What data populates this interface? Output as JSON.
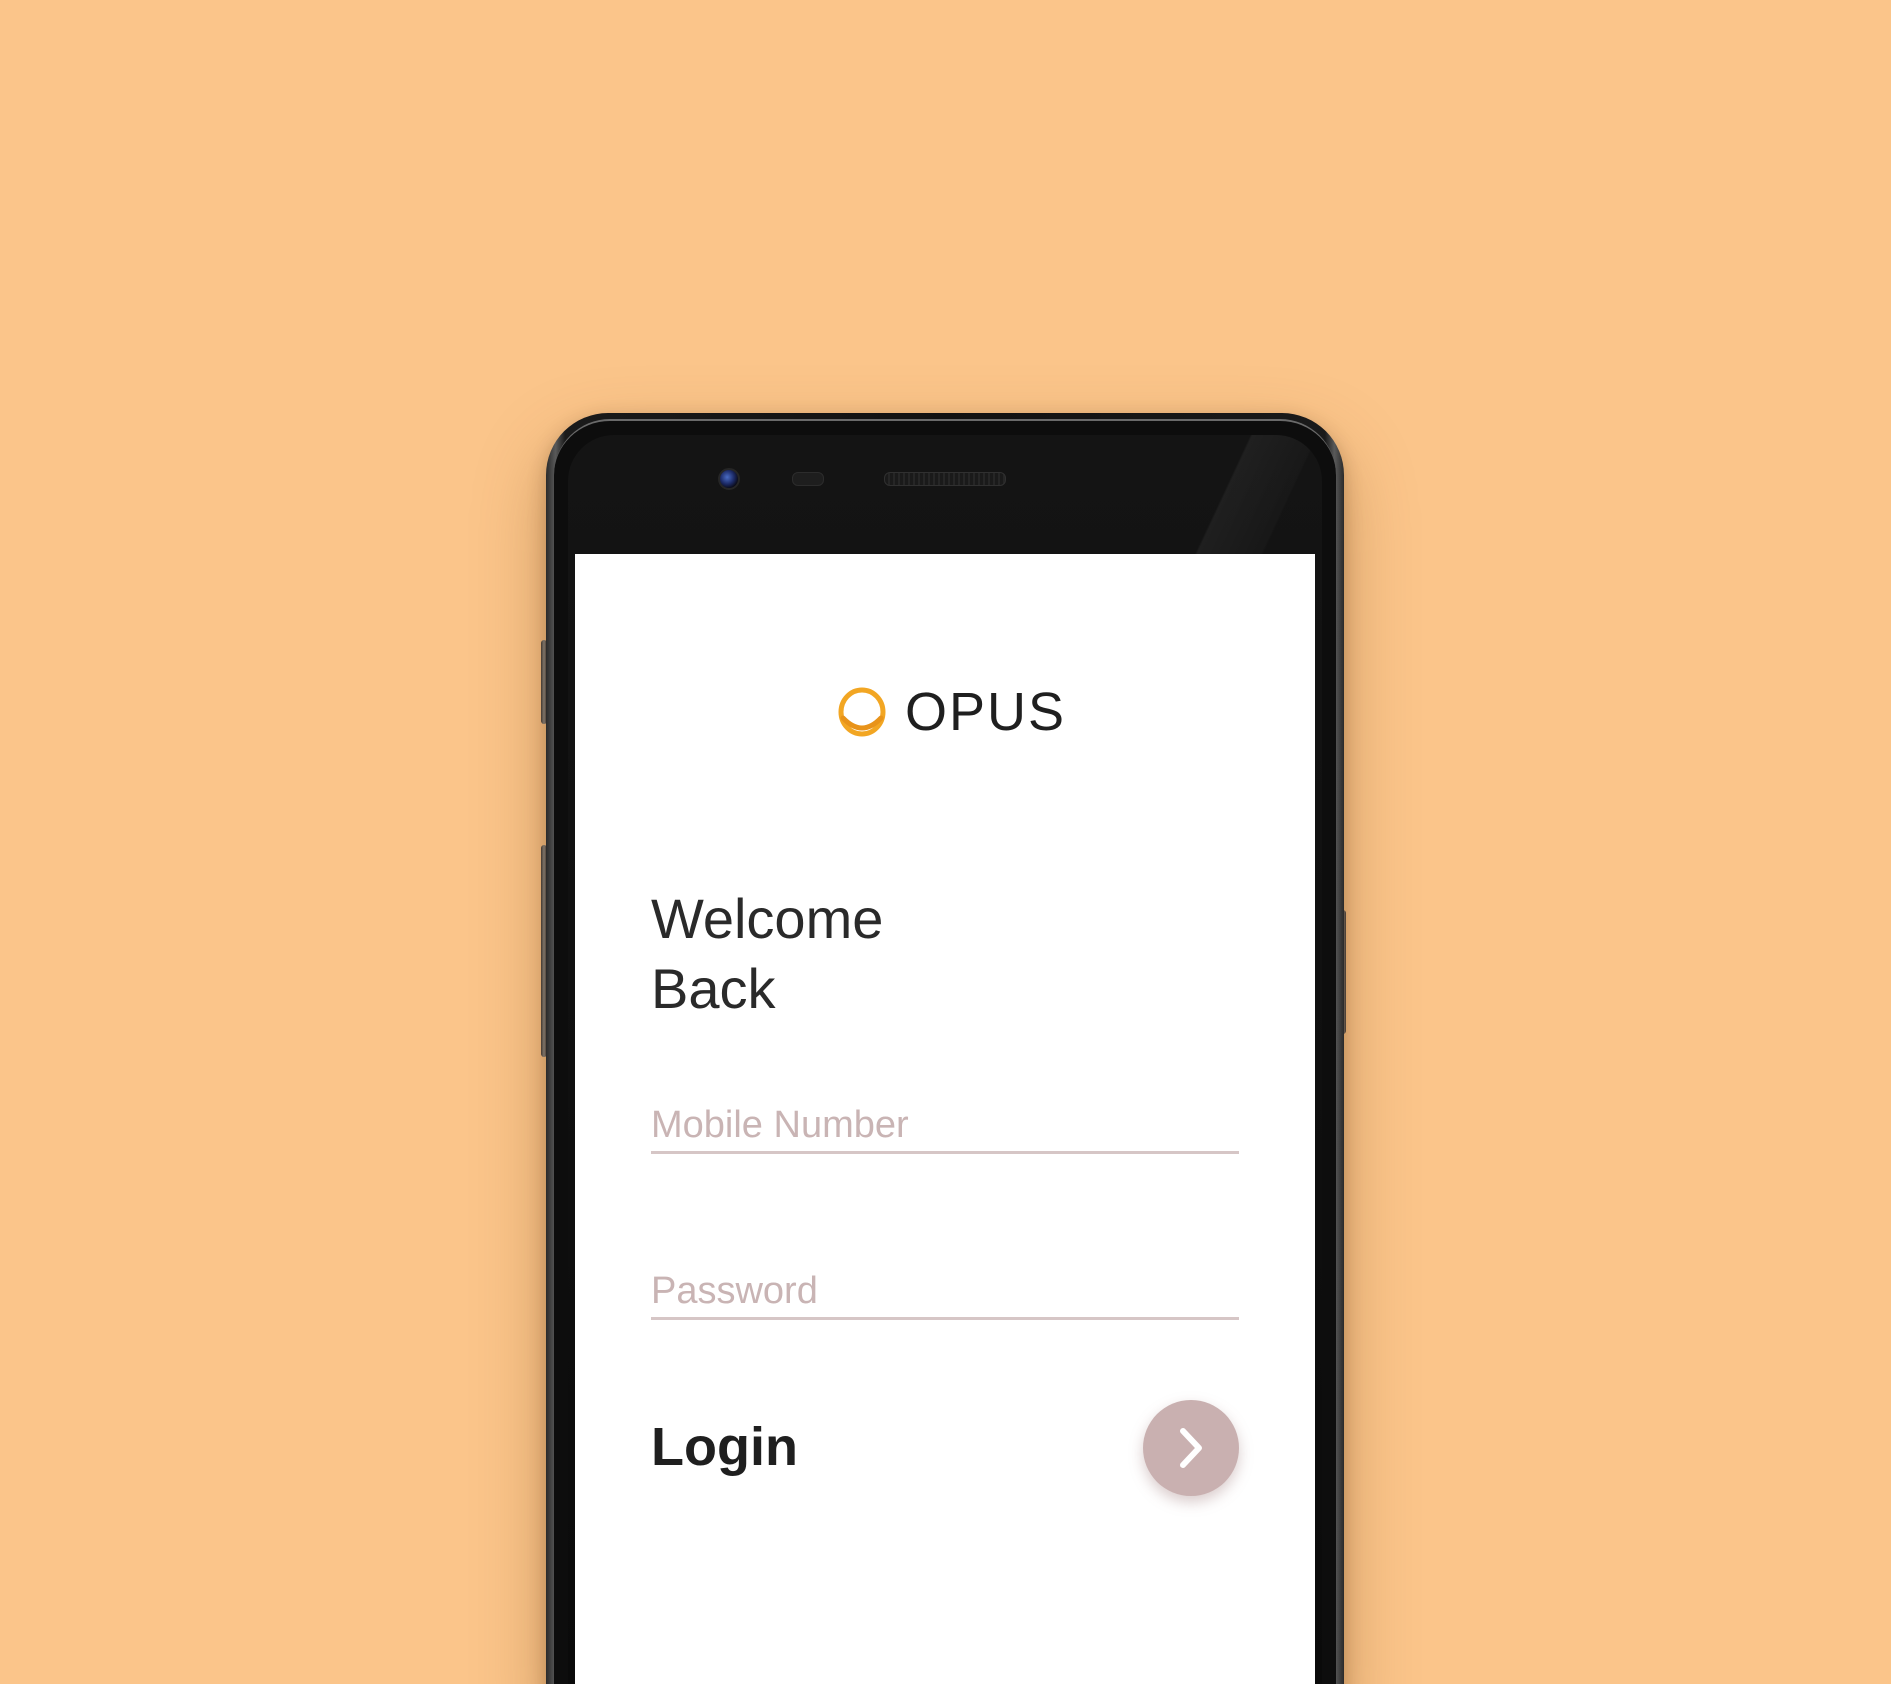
{
  "app": {
    "brand_name": "OPUS",
    "brand_color": "#f2a623"
  },
  "welcome": {
    "line1": "Welcome",
    "line2": "Back"
  },
  "form": {
    "mobile_placeholder": "Mobile Number",
    "mobile_value": "",
    "password_placeholder": "Password",
    "password_value": ""
  },
  "login": {
    "label": "Login",
    "button_icon": "chevron-right-icon",
    "button_color": "#c9b0b0"
  },
  "colors": {
    "background": "#fbc58a",
    "screen": "#ffffff",
    "field_underline": "#d6c6c6"
  }
}
